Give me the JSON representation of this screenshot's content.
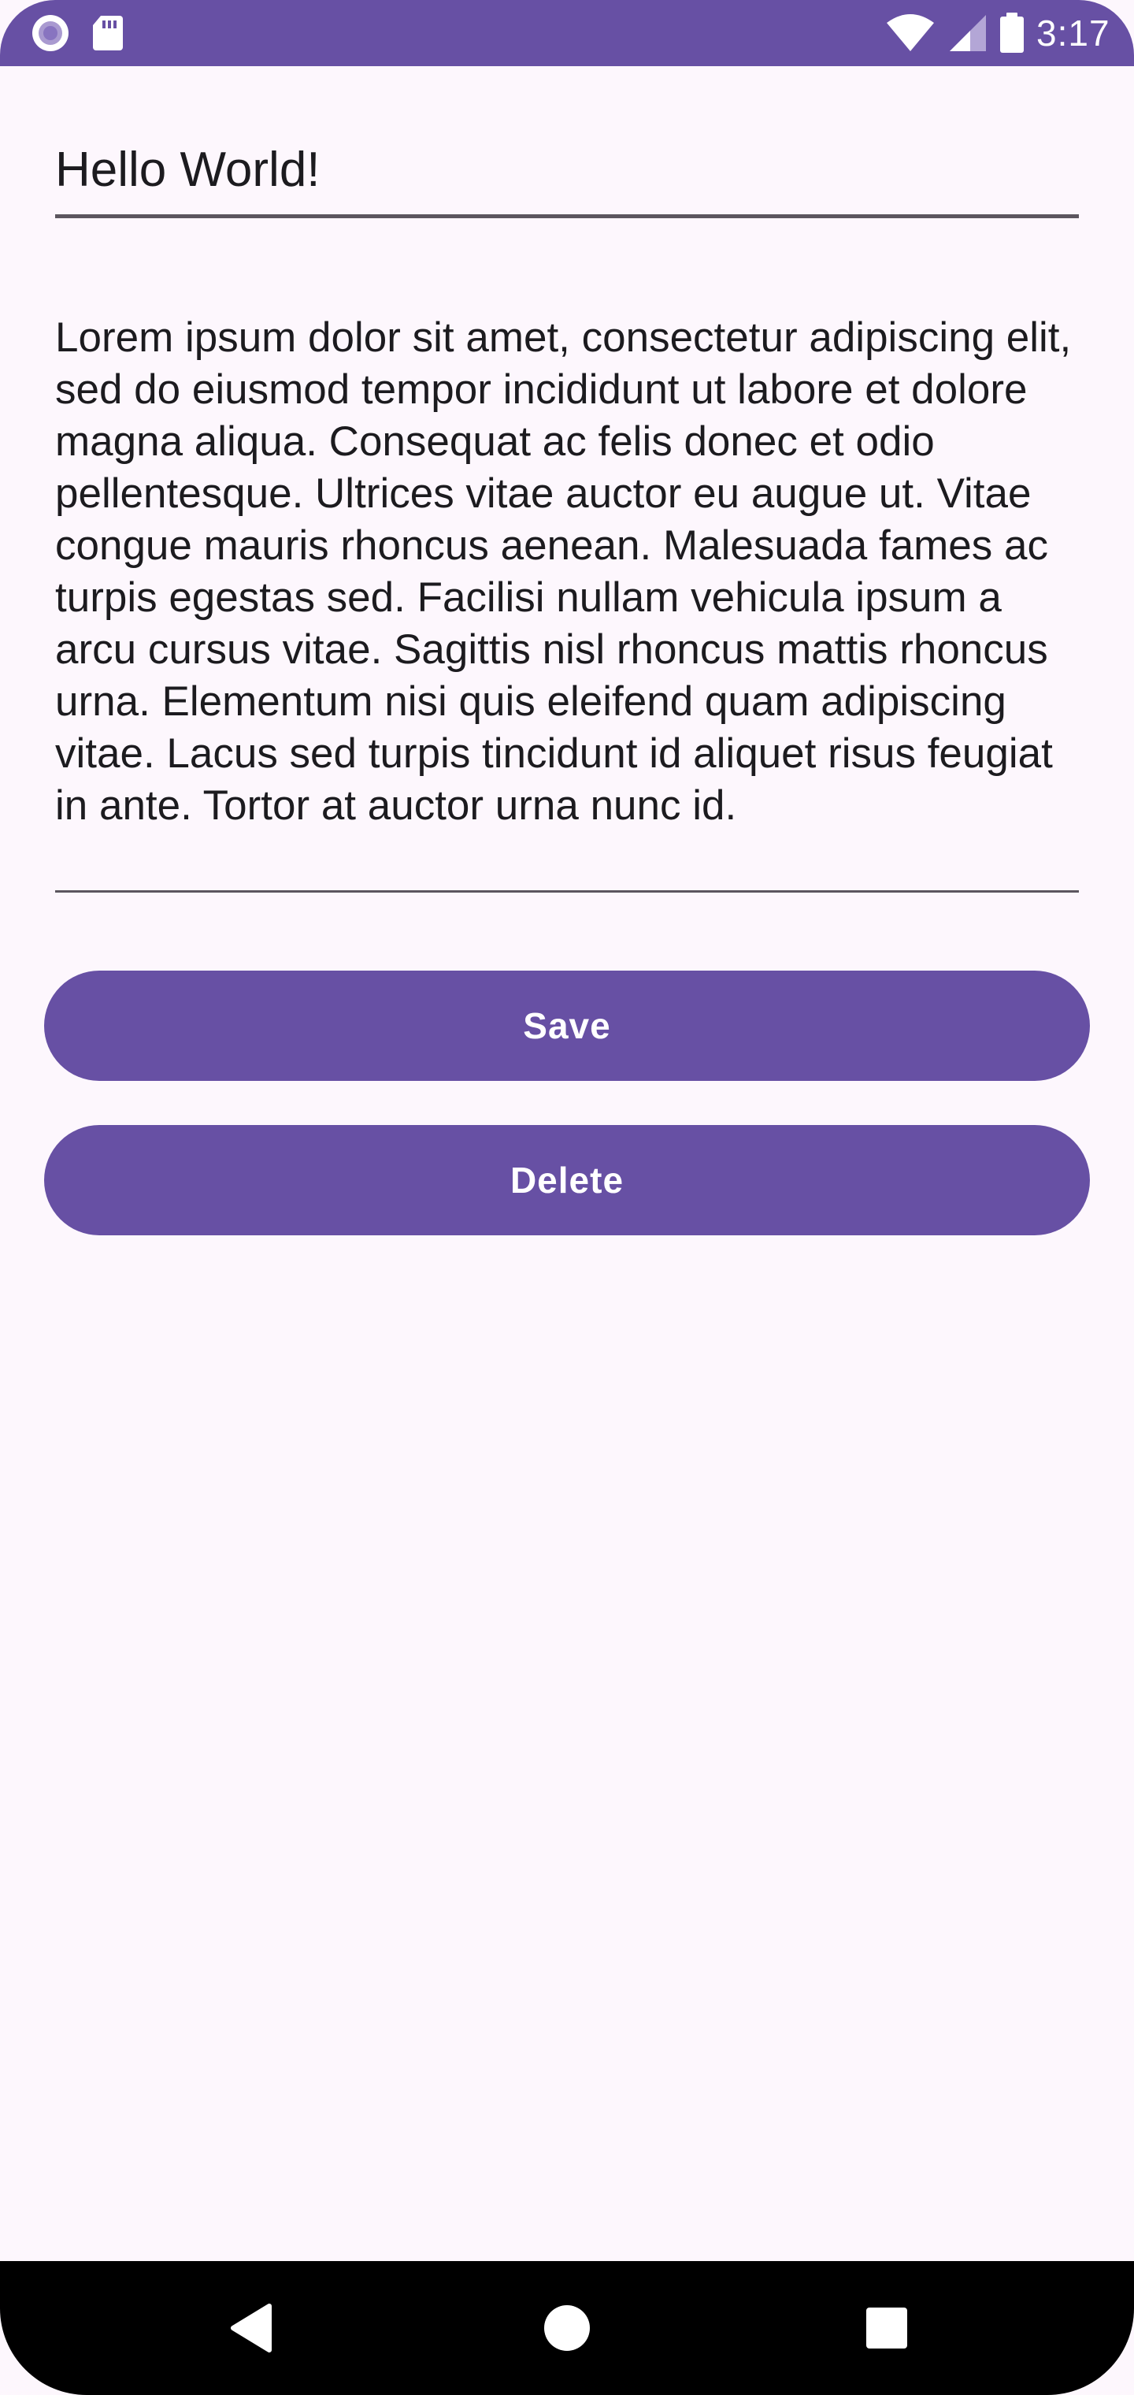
{
  "status_bar": {
    "time": "3:17",
    "left_icons": [
      "media-record-icon",
      "sd-card-icon"
    ],
    "right_icons": [
      "wifi-icon",
      "cell-signal-icon",
      "battery-icon"
    ]
  },
  "note": {
    "title": "Hello World!",
    "body": "Lorem ipsum dolor sit amet, consectetur adipiscing elit, sed do eiusmod tempor incididunt ut labore et dolore magna aliqua. Consequat ac felis donec et odio pellentesque. Ultrices vitae auctor eu augue ut. Vitae congue mauris rhoncus aenean. Malesuada fames ac turpis egestas sed. Facilisi nullam vehicula ipsum a arcu cursus vitae. Sagittis nisl rhoncus mattis rhoncus urna. Elementum nisi quis eleifend quam adipiscing vitae. Lacus sed turpis tincidunt id aliquet risus feugiat in ante. Tortor at auctor urna nunc id."
  },
  "actions": {
    "save_label": "Save",
    "delete_label": "Delete"
  },
  "nav_bar": {
    "icons": [
      "back-icon",
      "home-icon",
      "recents-icon"
    ]
  },
  "colors": {
    "primary": "#6750a4",
    "background": "#fdf7fd",
    "text": "#1c1b1f",
    "underline": "#5c565f",
    "nav_bar": "#000000"
  }
}
